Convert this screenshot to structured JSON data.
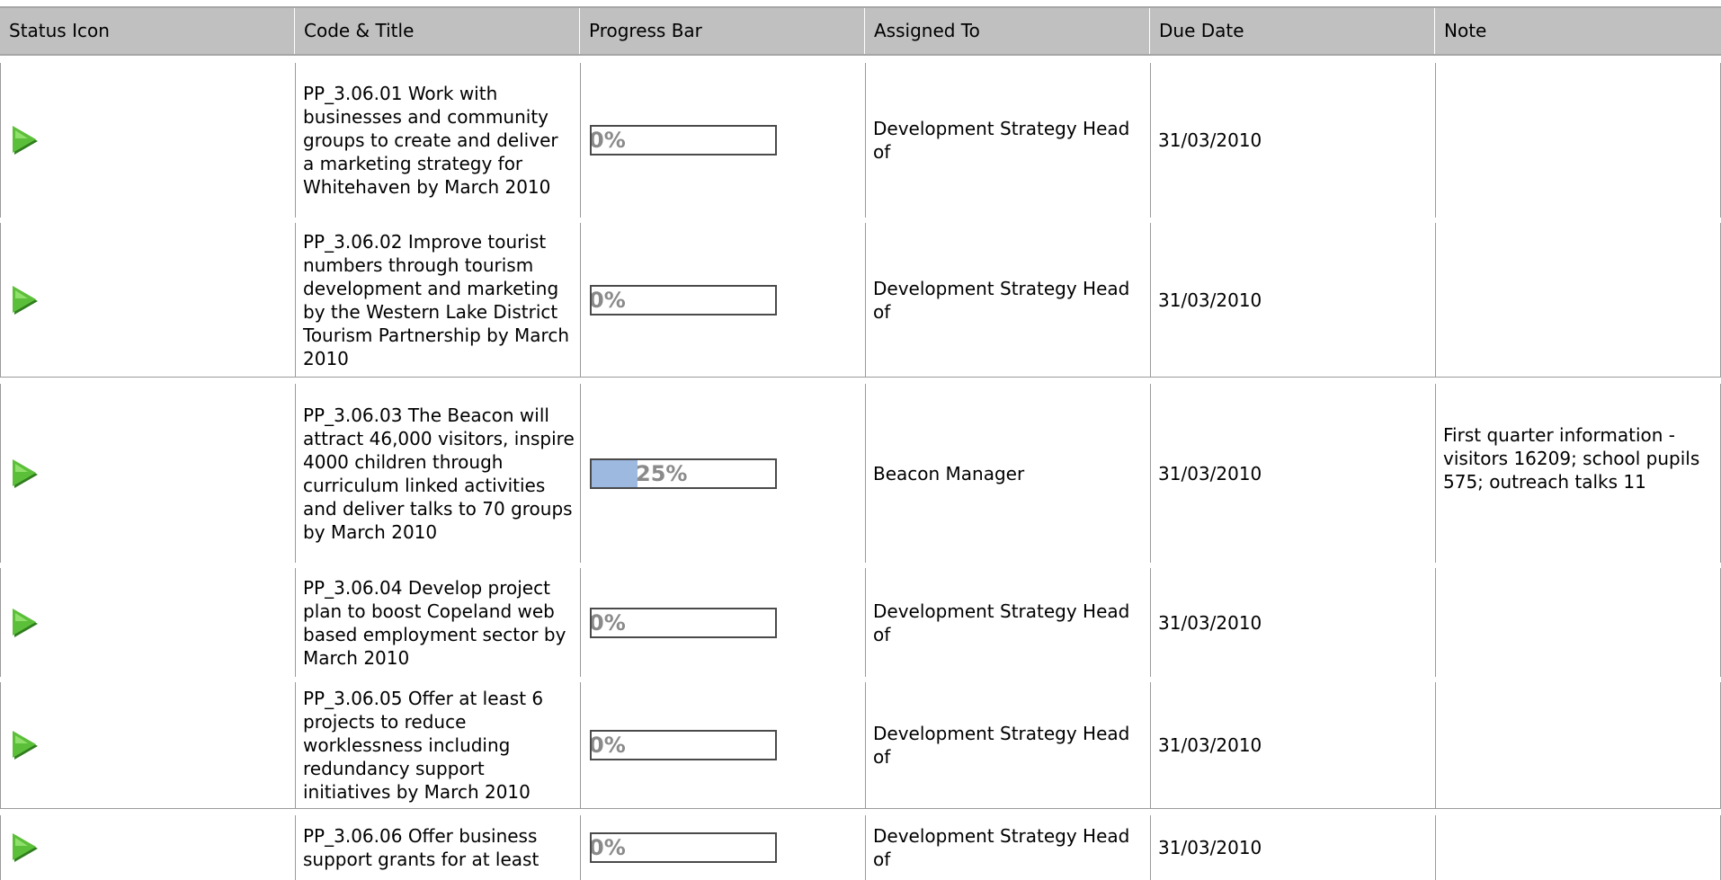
{
  "table": {
    "headers": [
      "Status Icon",
      "Code & Title",
      "Progress Bar",
      "Assigned To",
      "Due Date",
      "Note"
    ],
    "rows": [
      {
        "status_icon": "green-play-icon",
        "title": "PP_3.06.01 Work with businesses and community groups to create and deliver a marketing strategy for Whitehaven by March 2010",
        "progress_percent": 0,
        "progress_label": "0%",
        "assigned_to": "Development Strategy Head of",
        "due_date": "31/03/2010",
        "note": ""
      },
      {
        "status_icon": "green-play-icon",
        "title": "PP_3.06.02 Improve tourist numbers through tourism development and marketing by the Western Lake District Tourism Partnership by March 2010",
        "progress_percent": 0,
        "progress_label": "0%",
        "assigned_to": "Development Strategy Head of",
        "due_date": "31/03/2010",
        "note": ""
      },
      {
        "status_icon": "green-play-icon",
        "title": "PP_3.06.03 The Beacon will attract 46,000 visitors, inspire 4000 children through curriculum linked activities and deliver talks to 70 groups by March 2010",
        "progress_percent": 25,
        "progress_label": "25%",
        "assigned_to": "Beacon Manager",
        "due_date": "31/03/2010",
        "note": "First quarter information - visitors 16209; school pupils 575; outreach talks 11"
      },
      {
        "status_icon": "green-play-icon",
        "title": "PP_3.06.04 Develop project plan to boost Copeland web based employment sector by March 2010",
        "progress_percent": 0,
        "progress_label": "0%",
        "assigned_to": "Development Strategy Head of",
        "due_date": "31/03/2010",
        "note": ""
      },
      {
        "status_icon": "green-play-icon",
        "title": "PP_3.06.05 Offer at least 6 projects to reduce worklessness including redundancy support initiatives by March 2010",
        "progress_percent": 0,
        "progress_label": "0%",
        "assigned_to": "Development Strategy Head of",
        "due_date": "31/03/2010",
        "note": ""
      },
      {
        "status_icon": "green-play-icon",
        "title": "PP_3.06.06 Offer business support grants for at least",
        "progress_percent": 0,
        "progress_label": "0%",
        "assigned_to": "Development Strategy Head of",
        "due_date": "31/03/2010",
        "note": ""
      }
    ]
  },
  "colors": {
    "header_bg": "#c0c0c0",
    "status_icon": "#5cbf3a",
    "progress_fill": "#9db9e0",
    "progress_text": "#8a8a8a"
  }
}
